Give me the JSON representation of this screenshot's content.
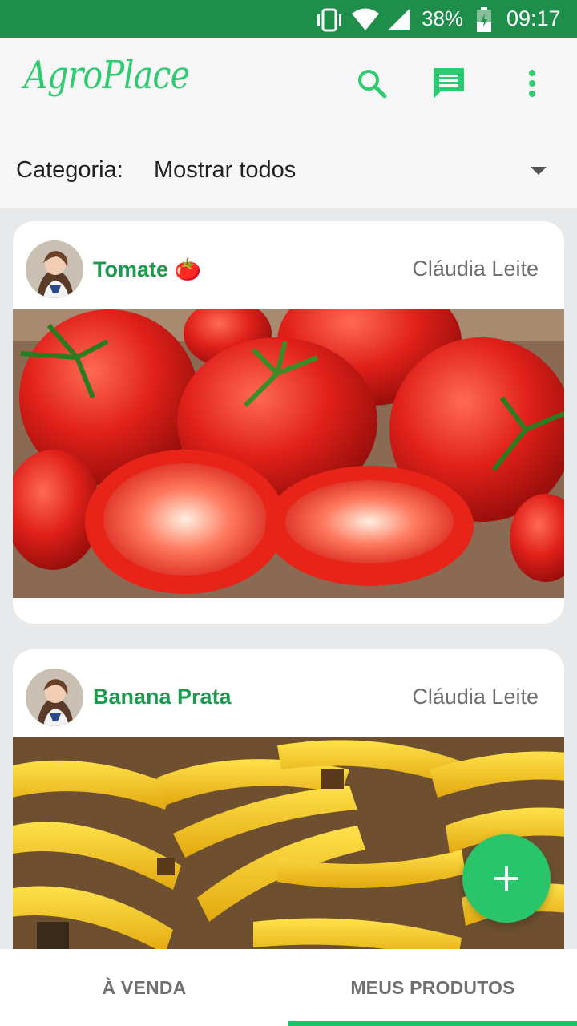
{
  "status_bar": {
    "battery_percent": "38%",
    "time": "09:17"
  },
  "app": {
    "title": "AgroPlace",
    "accent_color": "#2ecc71"
  },
  "toolbar": {
    "icons": [
      "search-icon",
      "chat-icon",
      "more-vert-icon"
    ]
  },
  "filter": {
    "label": "Categoria:",
    "selected": "Mostrar todos"
  },
  "listings": [
    {
      "product": "Tomate 🍅",
      "seller": "Cláudia Leite",
      "image": "tomatoes"
    },
    {
      "product": "Banana Prata",
      "seller": "Cláudia Leite",
      "image": "bananas"
    }
  ],
  "fab": {
    "icon": "plus-icon"
  },
  "tabs": [
    {
      "label": "À VENDA",
      "active": false
    },
    {
      "label": "MEUS PRODUTOS",
      "active": true
    }
  ]
}
